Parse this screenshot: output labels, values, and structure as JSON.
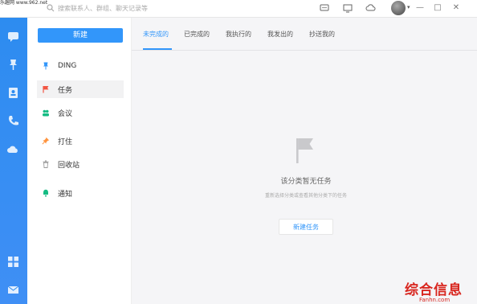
{
  "titlebar": {
    "watermark_text": "乐趣网 www.962.net",
    "search_placeholder": "搜索联系人、群组、聊天记录等"
  },
  "sidebar": {
    "new_button": "新建",
    "items": [
      {
        "label": "DING",
        "icon": "pin-icon",
        "color": "#3296fa"
      },
      {
        "label": "任务",
        "icon": "flag-icon",
        "color": "#f25643"
      },
      {
        "label": "会议",
        "icon": "group-icon",
        "color": "#15bc83"
      },
      {
        "label": "打住",
        "icon": "pushpin-icon",
        "color": "#ff943e"
      },
      {
        "label": "回收站",
        "icon": "trash-icon",
        "color": "#999999"
      },
      {
        "label": "通知",
        "icon": "bell-icon",
        "color": "#15bc83"
      }
    ]
  },
  "tabs": [
    {
      "label": "未完成的",
      "active": true
    },
    {
      "label": "已完成的",
      "active": false
    },
    {
      "label": "我执行的",
      "active": false
    },
    {
      "label": "我发出的",
      "active": false
    },
    {
      "label": "抄送我的",
      "active": false
    }
  ],
  "empty_state": {
    "title": "该分类暂无任务",
    "description": "重新选择分类或查看其他分类下的任务",
    "create_button": "新建任务"
  },
  "watermark": {
    "cn": "综合信息",
    "en": "Fanhn.com"
  },
  "colors": {
    "accent": "#3296fa",
    "leftbar": "#2d8cf0"
  }
}
